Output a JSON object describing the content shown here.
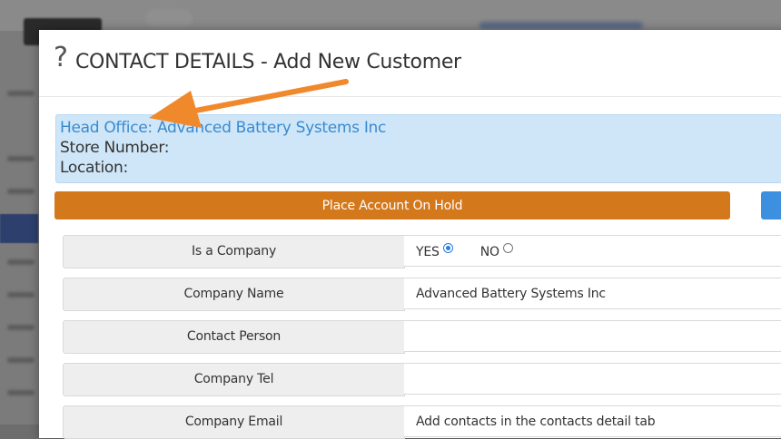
{
  "modal": {
    "help_icon": "?",
    "title": "CONTACT DETAILS - Add New Customer"
  },
  "info": {
    "head_office_label": "Head Office:",
    "head_office_value": "Advanced Battery Systems Inc",
    "store_number_label": "Store Number:",
    "store_number_value": "",
    "location_label": "Location:",
    "location_value": ""
  },
  "actions": {
    "hold_label": "Place Account On Hold"
  },
  "form": {
    "rows": [
      {
        "label": "Is a Company",
        "value": ""
      },
      {
        "label": "Company Name",
        "value": "Advanced Battery Systems Inc"
      },
      {
        "label": "Contact Person",
        "value": ""
      },
      {
        "label": "Company Tel",
        "value": ""
      },
      {
        "label": "Company Email",
        "value": "Add contacts in the contacts detail tab"
      }
    ],
    "is_company": {
      "yes_label": "YES",
      "no_label": "NO",
      "selected": "YES"
    }
  },
  "colors": {
    "accent_orange": "#d4781c",
    "info_blue": "#cfe6f8",
    "link_blue": "#3a8ad0",
    "annotation_arrow": "#f0882c"
  },
  "icons": {
    "help": "help-question-icon",
    "annotation": "annotation-arrow-icon"
  }
}
